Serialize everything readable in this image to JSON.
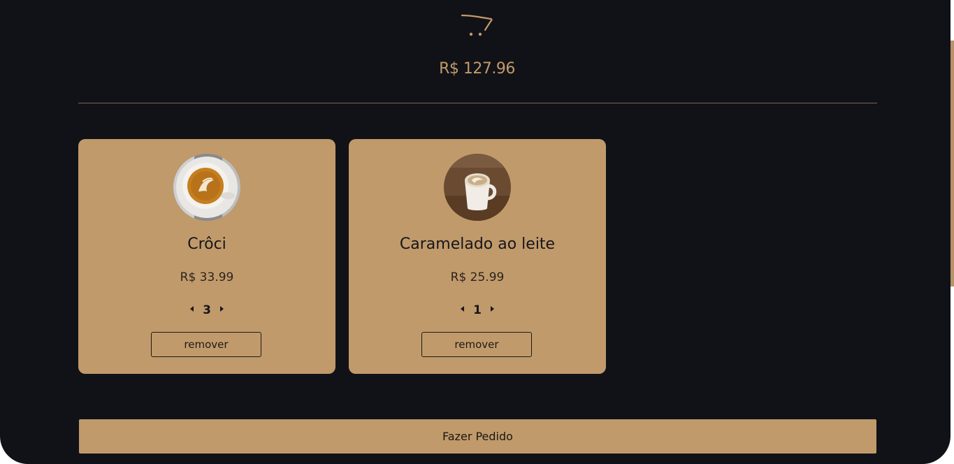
{
  "cart": {
    "icon": "shopping-cart-icon",
    "total": "R$ 127.96"
  },
  "items": [
    {
      "name": "Crôci",
      "price": "R$ 33.99",
      "quantity": "3",
      "remove_label": "remover",
      "image": "latte-art-coffee-photo"
    },
    {
      "name": "Caramelado ao leite",
      "price": "R$ 25.99",
      "quantity": "1",
      "remove_label": "remover",
      "image": "milk-coffee-cup-photo"
    }
  ],
  "order_button": {
    "label": "Fazer Pedido"
  },
  "colors": {
    "background": "#111217",
    "accent": "#c19a6b",
    "text_dark": "#16161a"
  }
}
